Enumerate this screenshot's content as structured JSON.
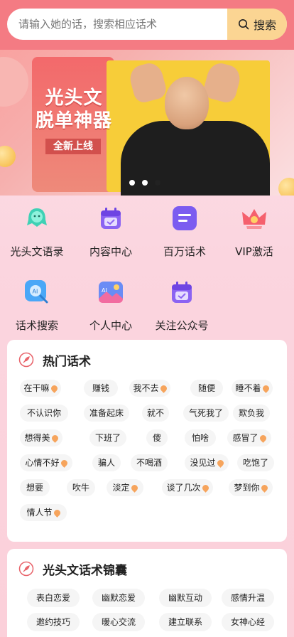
{
  "search": {
    "placeholder": "请输入她的话，搜索相应话术",
    "button_label": "搜索"
  },
  "banner": {
    "title_line1": "光头文",
    "title_line2": "脱单神器",
    "tag": "全新上线",
    "active_index": 2
  },
  "features": [
    {
      "label": "光头文语录",
      "icon": "voice-mascot-icon"
    },
    {
      "label": "内容中心",
      "icon": "calendar-icon"
    },
    {
      "label": "百万话术",
      "icon": "chat-icon"
    },
    {
      "label": "VIP激活",
      "icon": "crown-icon"
    },
    {
      "label": "话术搜索",
      "icon": "ai-search-icon"
    },
    {
      "label": "个人中心",
      "icon": "ai-image-icon"
    },
    {
      "label": "关注公众号",
      "icon": "calendar-icon"
    }
  ],
  "hot": {
    "title": "热门话术",
    "tags": [
      {
        "label": "在干嘛",
        "hot": true
      },
      {
        "label": "赚钱",
        "hot": false
      },
      {
        "label": "我不去",
        "hot": true
      },
      {
        "label": "随便",
        "hot": false
      },
      {
        "label": "睡不着",
        "hot": true
      },
      {
        "label": "不认识你",
        "hot": false
      },
      {
        "label": "准备起床",
        "hot": false
      },
      {
        "label": "就不",
        "hot": false
      },
      {
        "label": "气死我了",
        "hot": false
      },
      {
        "label": "欺负我",
        "hot": false
      },
      {
        "label": "想得美",
        "hot": true
      },
      {
        "label": "下班了",
        "hot": false
      },
      {
        "label": "傻",
        "hot": false
      },
      {
        "label": "怕啥",
        "hot": false
      },
      {
        "label": "感冒了",
        "hot": true
      },
      {
        "label": "心情不好",
        "hot": true
      },
      {
        "label": "骗人",
        "hot": false
      },
      {
        "label": "不喝酒",
        "hot": false
      },
      {
        "label": "没见过",
        "hot": true
      },
      {
        "label": "吃饱了",
        "hot": false
      },
      {
        "label": "想要",
        "hot": false
      },
      {
        "label": "吹牛",
        "hot": false
      },
      {
        "label": "淡定",
        "hot": true
      },
      {
        "label": "谈了几次",
        "hot": true
      },
      {
        "label": "梦到你",
        "hot": true
      },
      {
        "label": "情人节",
        "hot": true
      }
    ]
  },
  "kit": {
    "title": "光头文话术锦囊",
    "tags": [
      "表白恋爱",
      "幽默恋爱",
      "幽默互动",
      "感情升温",
      "邀约技巧",
      "暖心交流",
      "建立联系",
      "女神心经"
    ]
  }
}
